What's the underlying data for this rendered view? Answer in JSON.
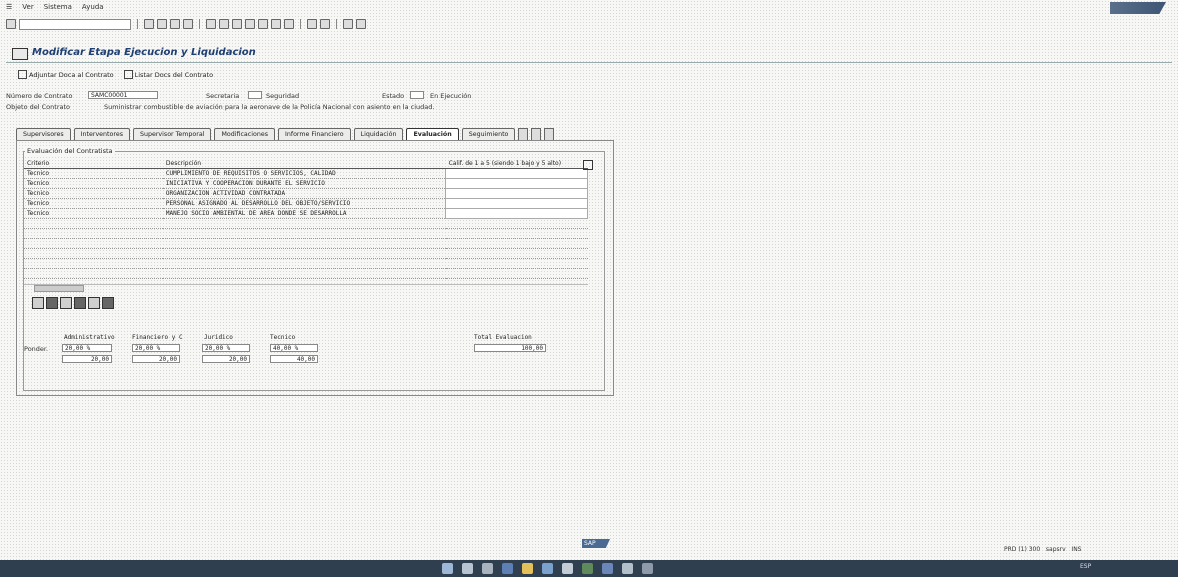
{
  "menu": [
    "Ver",
    "Sistema",
    "Ayuda"
  ],
  "title": "Modificar Etapa Ejecucion y Liquidacion",
  "app_buttons": [
    "Adjuntar Doca al Contrato",
    "Listar Docs del Contrato"
  ],
  "header": {
    "numero_label": "Número de Contrato",
    "numero_value": "SAMC00001",
    "secretaria_label": "Secretaria",
    "secretaria_value": "Seguridad",
    "estado_label": "Estado",
    "estado_value": "En Ejecución",
    "objeto_label": "Objeto del Contrato",
    "objeto_value": "Suministrar combustible de aviación para la aeronave de la Policía Nacional con asiento en la ciudad."
  },
  "tabs": [
    "Supervisores",
    "Interventores",
    "Supervisor Temporal",
    "Modificaciones",
    "Informe Financiero",
    "Liquidación",
    "Evaluación",
    "Seguimiento"
  ],
  "active_tab": "Evaluación",
  "evaluation": {
    "group_title": "Evaluación del Contratista",
    "columns": [
      "Criterio",
      "Descripción",
      "Calif. de 1 a 5 (siendo 1 bajo y 5 alto)"
    ],
    "rows": [
      {
        "criterio": "Tecnico",
        "descripcion": "CUMPLIMIENTO DE REQUISITOS O SERVICIOS, CALIDAD",
        "calif": ""
      },
      {
        "criterio": "Tecnico",
        "descripcion": "INICIATIVA Y COOPERACION DURANTE EL SERVICIO",
        "calif": ""
      },
      {
        "criterio": "Tecnico",
        "descripcion": "ORGANIZACION ACTIVIDAD CONTRATADA",
        "calif": ""
      },
      {
        "criterio": "Tecnico",
        "descripcion": "PERSONAL ASIGNADO AL DESARROLLO DEL OBJETO/SERVICIO",
        "calif": ""
      },
      {
        "criterio": "Tecnico",
        "descripcion": "MANEJO SOCIO AMBIENTAL DE AREA DONDE SE DESARROLLA",
        "calif": ""
      }
    ]
  },
  "weights": {
    "row_label": "Ponder.",
    "headers": [
      "Administrativo",
      "Financiero y C",
      "Juridico",
      "Tecnico",
      "Total Evaluacion"
    ],
    "ponderacion": [
      "20,00 %",
      "20,00 %",
      "20,00 %",
      "40,00 %"
    ],
    "puntajes": [
      "20,00",
      "20,00",
      "20,00",
      "40,00"
    ],
    "total": "100,00"
  },
  "status": {
    "system": "PRD (1) 300",
    "server": "sapsrv",
    "mode": "INS"
  },
  "colors": {
    "title": "#1f3f72",
    "taskbar": "#2f3f4f"
  }
}
